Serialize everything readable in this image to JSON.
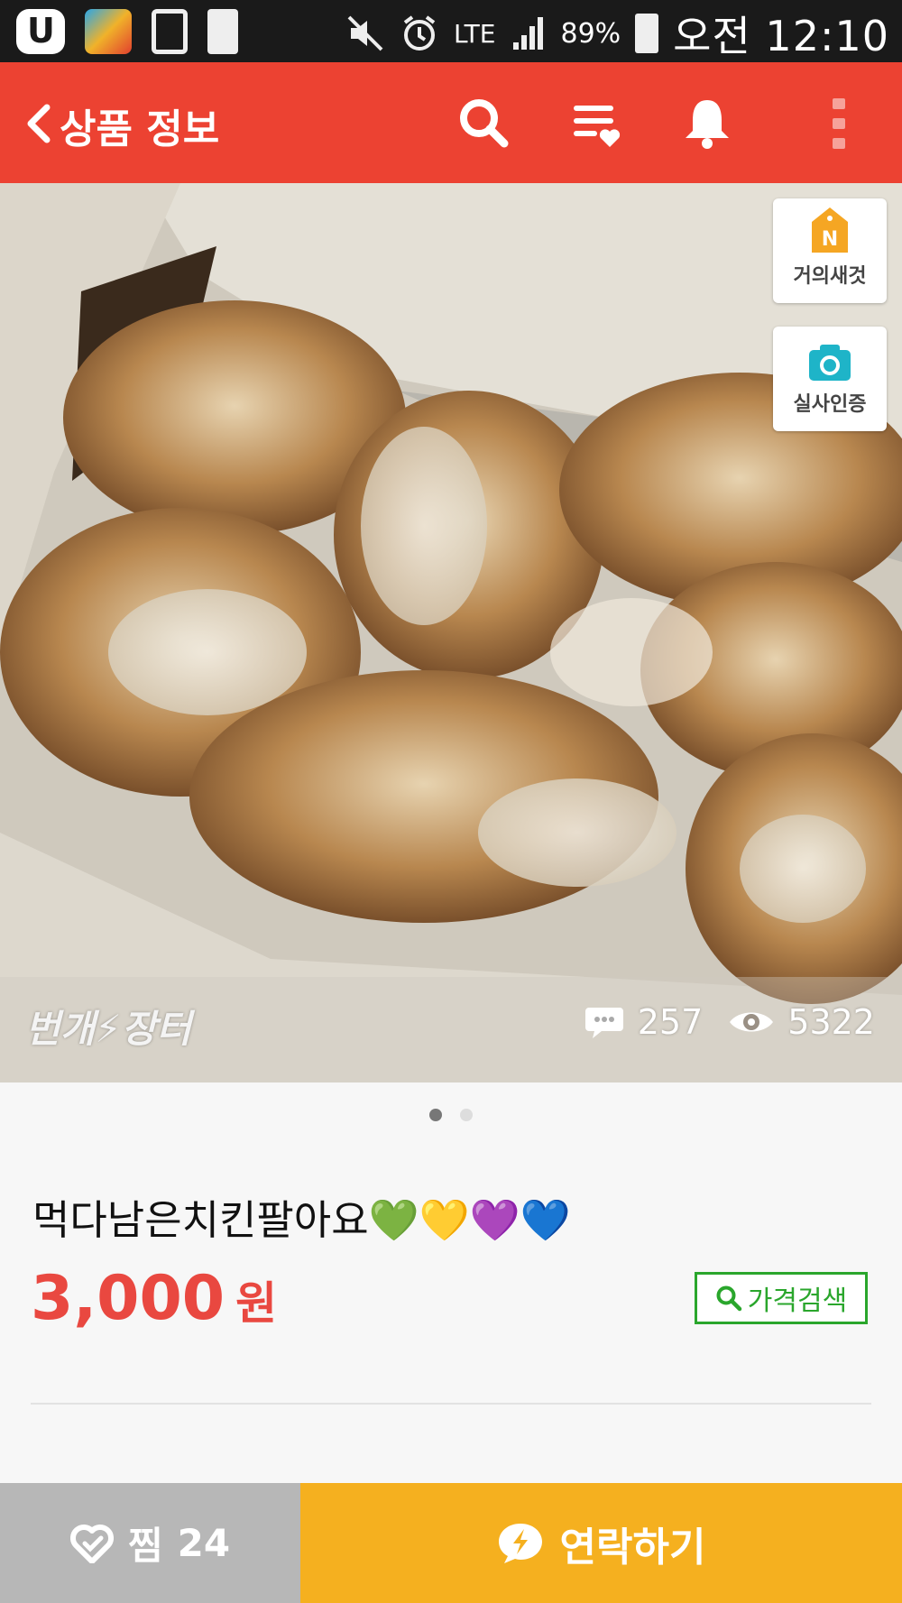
{
  "status_bar": {
    "battery": "89%",
    "network": "LTE",
    "time": "오전 12:10",
    "icons": [
      "u-plus-icon",
      "netmarble-app-icon",
      "device-clock-icon",
      "recycle-battery-icon",
      "mute-icon",
      "alarm-icon",
      "signal-icon",
      "battery-icon"
    ]
  },
  "app_bar": {
    "title": "상품 정보",
    "icons": [
      "back-arrow-icon",
      "search-icon",
      "wishlist-icon",
      "bell-icon",
      "more-vertical-icon"
    ]
  },
  "photo": {
    "badges": [
      {
        "label": "거의새것",
        "icon": "new-tag-icon",
        "icon_text": "N"
      },
      {
        "label": "실사인증",
        "icon": "camera-icon"
      }
    ],
    "watermark": "번개⚡장터",
    "comments": "257",
    "views": "5322",
    "page_dots": 2,
    "active_dot": 1
  },
  "product": {
    "title": "먹다남은치킨팔아요💚💛💜💙",
    "price": "3,000",
    "currency": "원",
    "price_search_label": "가격검색"
  },
  "bottom_bar": {
    "zzim_label": "찜",
    "zzim_count": "24",
    "contact_label": "연락하기"
  },
  "colors": {
    "accent": "#ec4232",
    "price": "#e94840",
    "price_search": "#2aa62c",
    "contact_bg": "#f5b01f",
    "zzim_bg": "#b7b7b7"
  }
}
